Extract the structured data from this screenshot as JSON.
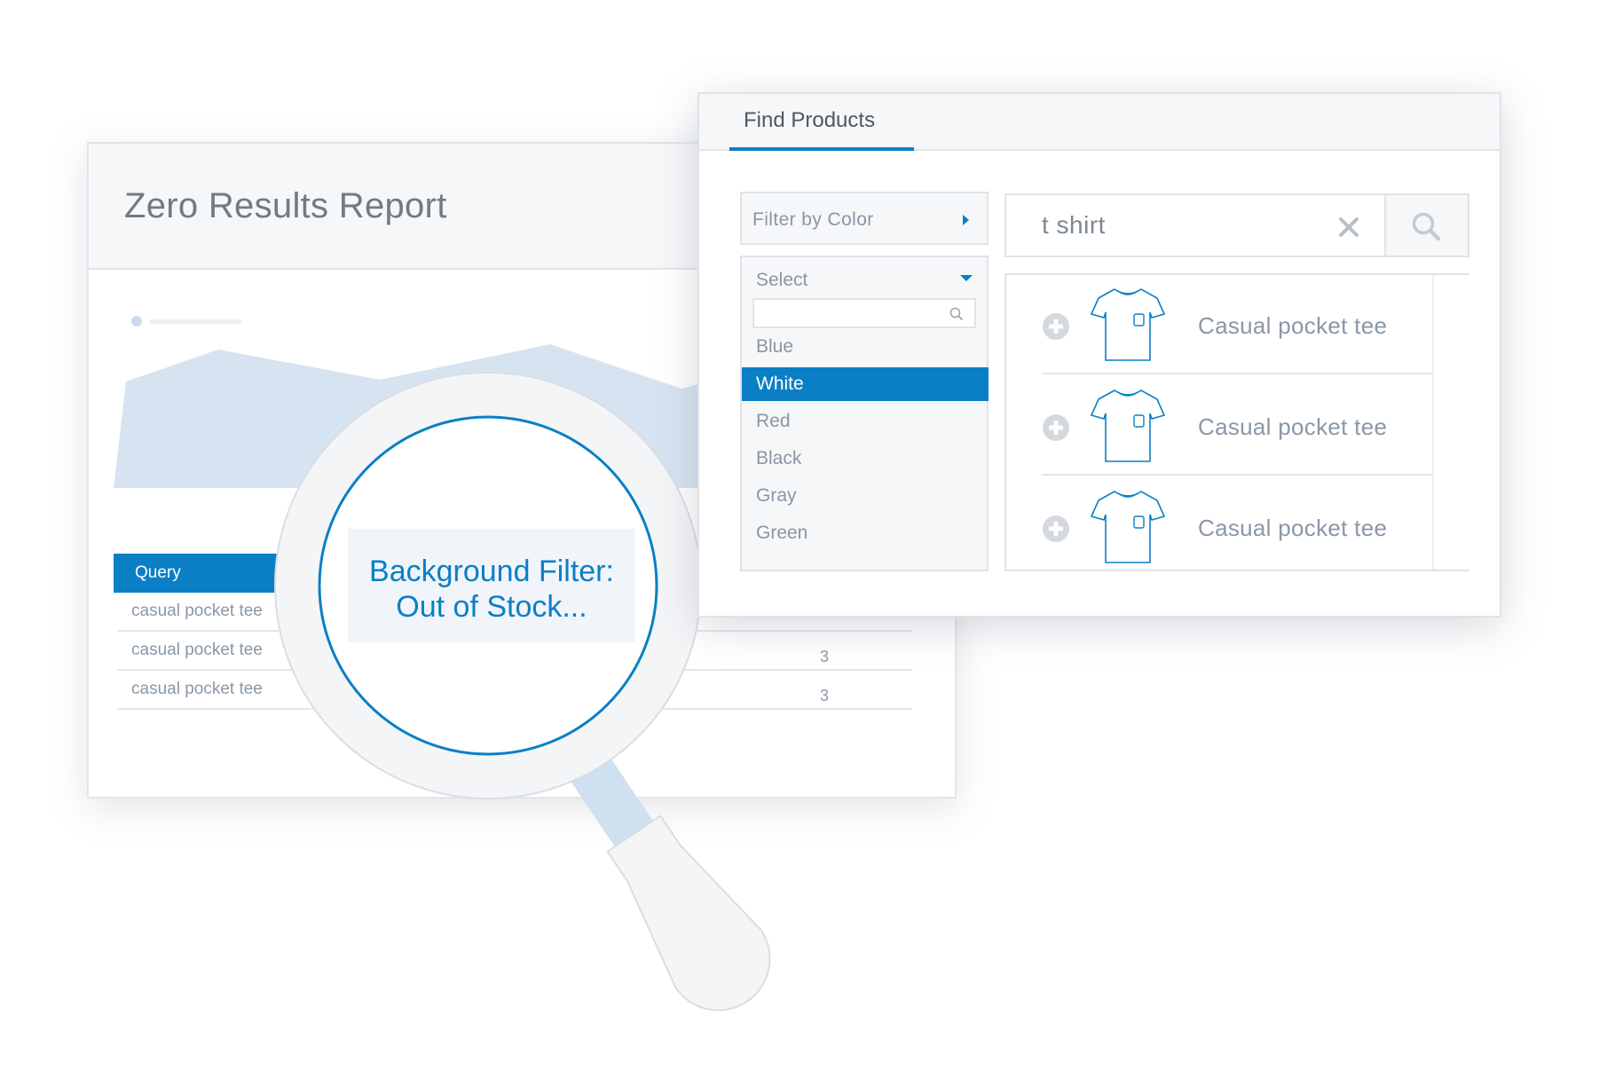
{
  "report": {
    "title": "Zero Results Report",
    "table": {
      "header": "Query",
      "rows": [
        {
          "query": "casual pocket tee",
          "count": ""
        },
        {
          "query": "casual pocket tee",
          "count": "3"
        },
        {
          "query": "casual pocket tee",
          "count": "3"
        }
      ]
    }
  },
  "finder": {
    "tab": "Find Products",
    "filter_label": "Filter by Color",
    "select": {
      "placeholder": "Select",
      "options": [
        "Blue",
        "White",
        "Red",
        "Black",
        "Gray",
        "Green"
      ],
      "selected": "White"
    },
    "search": {
      "value": "t shirt"
    },
    "results": [
      {
        "name": "Casual pocket tee",
        "icon": "tshirt-icon"
      },
      {
        "name": "Casual pocket tee",
        "icon": "tshirt-icon"
      },
      {
        "name": "Casual pocket tee",
        "icon": "tshirt-icon"
      }
    ]
  },
  "magnifier": {
    "line1": "Background Filter:",
    "line2": "Out of Stock..."
  },
  "colors": {
    "accent": "#0a7fc6",
    "chart_fill": "#d6e3f0",
    "border": "#dfe3e8",
    "text_muted": "#8a97a6"
  }
}
